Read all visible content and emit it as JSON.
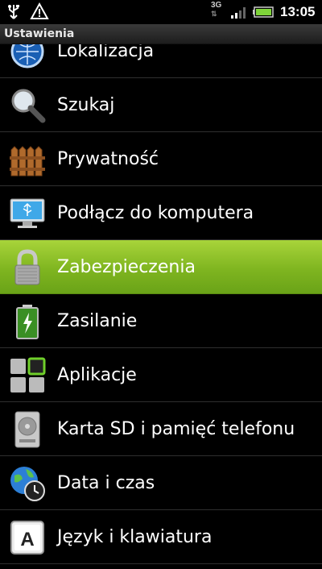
{
  "status_bar": {
    "network": "3G",
    "time": "13:05",
    "icons": [
      "usb-icon",
      "warning-icon",
      "signal-icon",
      "battery-icon"
    ]
  },
  "title_bar": {
    "title": "Ustawienia"
  },
  "settings": [
    {
      "label": "Lokalizacja",
      "icon": "location-globe-icon"
    },
    {
      "label": "Szukaj",
      "icon": "magnifier-icon"
    },
    {
      "label": "Prywatność",
      "icon": "fence-icon"
    },
    {
      "label": "Podłącz do komputera",
      "icon": "computer-usb-icon"
    },
    {
      "label": "Zabezpieczenia",
      "icon": "padlock-icon",
      "selected": true
    },
    {
      "label": "Zasilanie",
      "icon": "battery-charge-icon"
    },
    {
      "label": "Aplikacje",
      "icon": "apps-grid-icon"
    },
    {
      "label": "Karta SD i pamięć telefonu",
      "icon": "storage-drive-icon"
    },
    {
      "label": "Data i czas",
      "icon": "globe-clock-icon"
    },
    {
      "label": "Język i klawiatura",
      "icon": "keyboard-key-icon"
    }
  ],
  "colors": {
    "selected_gradient_top": "#a8d43a",
    "selected_gradient_bottom": "#6aa318",
    "divider": "#2f2f2f"
  },
  "keyboard_key_letter": "A"
}
